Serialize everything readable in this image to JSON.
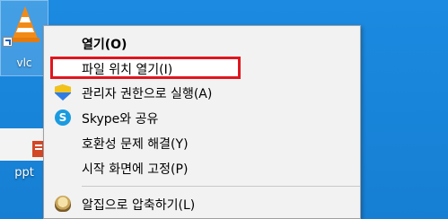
{
  "desktop": {
    "icons": [
      {
        "label": "vlc"
      },
      {
        "label": "ppt"
      }
    ]
  },
  "context_menu": {
    "items": [
      {
        "label": "열기(O)",
        "bold": true
      },
      {
        "label": "파일 위치 열기(I)",
        "highlighted": true
      },
      {
        "label": "관리자 권한으로 실행(A)",
        "icon": "uac-shield-icon"
      },
      {
        "label": "Skype와 공유",
        "icon": "skype-icon"
      },
      {
        "label": "호환성 문제 해결(Y)"
      },
      {
        "label": "시작 화면에 고정(P)"
      },
      {
        "label": "알집으로 압축하기(L)",
        "icon": "alzip-icon"
      }
    ]
  },
  "colors": {
    "desktop_background": "#1a86d8",
    "highlight_border": "#e0161e"
  }
}
